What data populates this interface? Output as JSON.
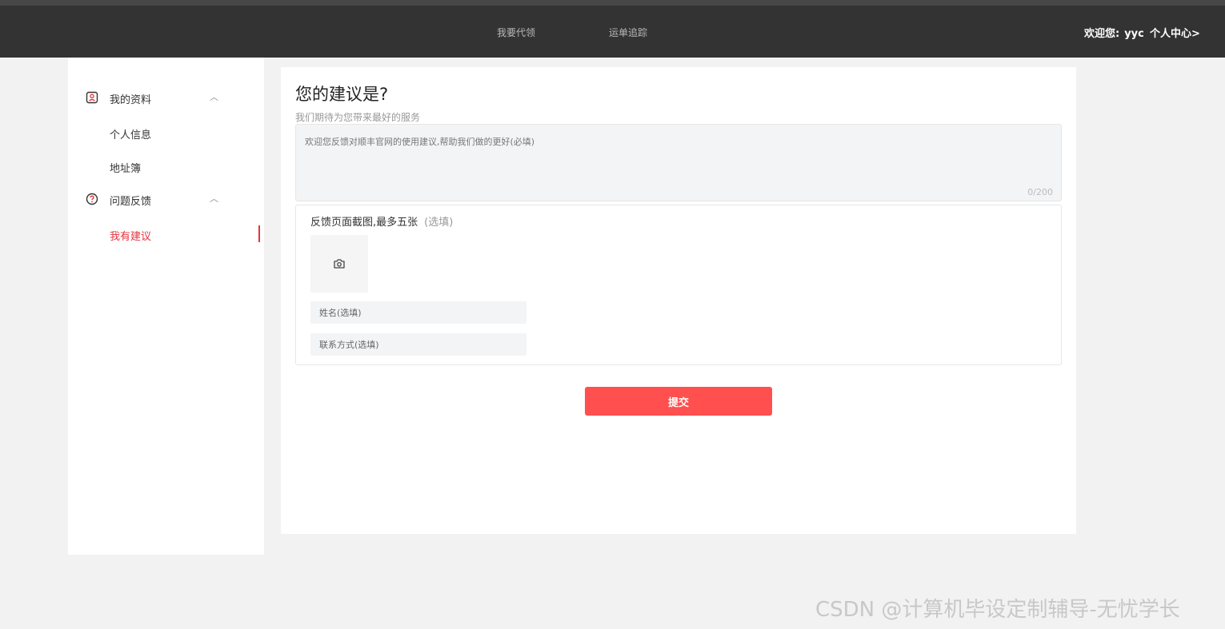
{
  "header": {
    "nav": [
      "我要代领",
      "运单追踪"
    ],
    "welcome_label": "欢迎您:",
    "username": "yyc",
    "center_link": "个人中心>"
  },
  "sidebar": {
    "groups": [
      {
        "label": "我的资料",
        "icon": "profile-icon",
        "items": [
          "个人信息",
          "地址簿"
        ]
      },
      {
        "label": "问题反馈",
        "icon": "question-icon",
        "items": [
          "我有建议"
        ]
      }
    ],
    "active_item": "我有建议"
  },
  "main": {
    "title": "您的建议是?",
    "subtitle": "我们期待为您带来最好的服务",
    "feedback_placeholder": "欢迎您反馈对顺丰官网的使用建议,帮助我们做的更好(必填)",
    "counter": "0/200",
    "upload_title": "反馈页面截图,最多五张",
    "upload_optional": "(选填)",
    "name_placeholder": "姓名(选填)",
    "contact_placeholder": "联系方式(选填)",
    "submit_label": "提交"
  },
  "watermark": "CSDN @计算机毕设定制辅导-无忧学长",
  "colors": {
    "accent": "#e8323c",
    "submit": "#ff4f4f",
    "header_bg": "#333333"
  }
}
